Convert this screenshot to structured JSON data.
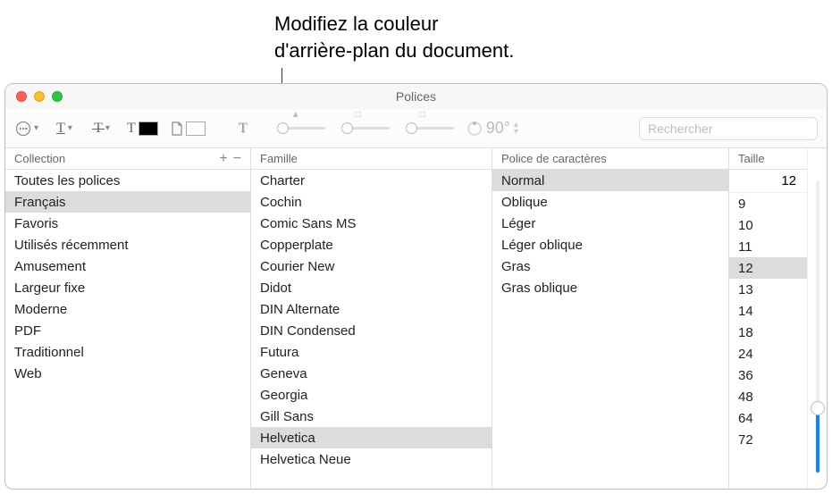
{
  "callout": {
    "line1": "Modifiez la couleur",
    "line2": "d'arrière-plan du document."
  },
  "window": {
    "title": "Polices"
  },
  "toolbar": {
    "rotation": "90°",
    "search_placeholder": "Rechercher"
  },
  "columns": {
    "collection": {
      "header": "Collection",
      "items": [
        {
          "label": "Toutes les polices",
          "selected": false
        },
        {
          "label": "Français",
          "selected": true
        },
        {
          "label": "Favoris",
          "selected": false
        },
        {
          "label": "Utilisés récemment",
          "selected": false
        },
        {
          "label": "Amusement",
          "selected": false
        },
        {
          "label": "Largeur fixe",
          "selected": false
        },
        {
          "label": "Moderne",
          "selected": false
        },
        {
          "label": "PDF",
          "selected": false
        },
        {
          "label": "Traditionnel",
          "selected": false
        },
        {
          "label": "Web",
          "selected": false
        }
      ]
    },
    "family": {
      "header": "Famille",
      "items": [
        {
          "label": "Charter",
          "selected": false
        },
        {
          "label": "Cochin",
          "selected": false
        },
        {
          "label": "Comic Sans MS",
          "selected": false
        },
        {
          "label": "Copperplate",
          "selected": false
        },
        {
          "label": "Courier New",
          "selected": false
        },
        {
          "label": "Didot",
          "selected": false
        },
        {
          "label": "DIN Alternate",
          "selected": false
        },
        {
          "label": "DIN Condensed",
          "selected": false
        },
        {
          "label": "Futura",
          "selected": false
        },
        {
          "label": "Geneva",
          "selected": false
        },
        {
          "label": "Georgia",
          "selected": false
        },
        {
          "label": "Gill Sans",
          "selected": false
        },
        {
          "label": "Helvetica",
          "selected": true
        },
        {
          "label": "Helvetica Neue",
          "selected": false
        }
      ]
    },
    "typeface": {
      "header": "Police de caractères",
      "items": [
        {
          "label": "Normal",
          "selected": true
        },
        {
          "label": "Oblique",
          "selected": false
        },
        {
          "label": "Léger",
          "selected": false
        },
        {
          "label": "Léger oblique",
          "selected": false
        },
        {
          "label": "Gras",
          "selected": false
        },
        {
          "label": "Gras oblique",
          "selected": false
        }
      ]
    },
    "size": {
      "header": "Taille",
      "current": "12",
      "items": [
        {
          "label": "9",
          "selected": false
        },
        {
          "label": "10",
          "selected": false
        },
        {
          "label": "11",
          "selected": false
        },
        {
          "label": "12",
          "selected": true
        },
        {
          "label": "13",
          "selected": false
        },
        {
          "label": "14",
          "selected": false
        },
        {
          "label": "18",
          "selected": false
        },
        {
          "label": "24",
          "selected": false
        },
        {
          "label": "36",
          "selected": false
        },
        {
          "label": "48",
          "selected": false
        },
        {
          "label": "64",
          "selected": false
        },
        {
          "label": "72",
          "selected": false
        }
      ]
    }
  }
}
